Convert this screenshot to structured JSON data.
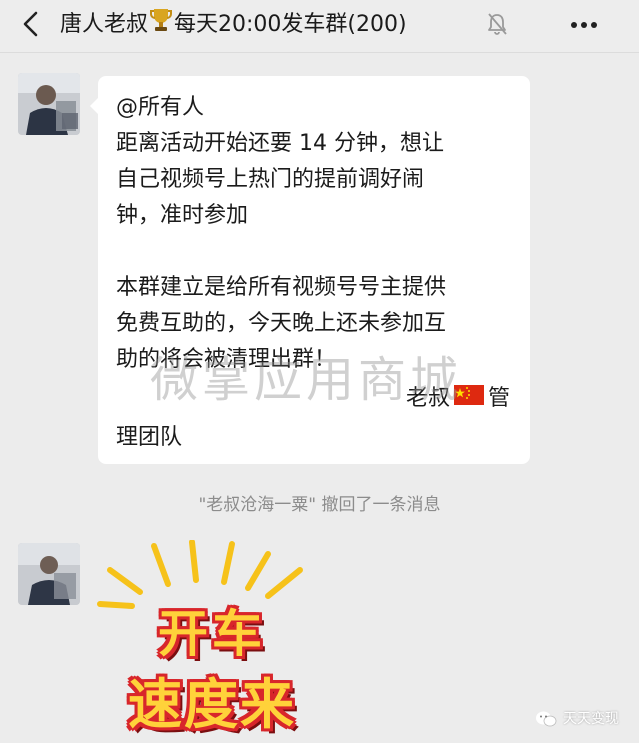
{
  "header": {
    "title_prefix": "唐人老叔",
    "title_suffix": "每天20:00发车群(200)",
    "icons": [
      "back-icon",
      "trophy-icon",
      "mute-bell-icon",
      "more-icon"
    ]
  },
  "message": {
    "lines_part1": [
      "@所有人",
      "距离活动开始还要 14 分钟，想让",
      "自己视频号上热门的提前调好闹",
      "钟，准时参加"
    ],
    "lines_part2": [
      "本群建立是给所有视频号号主提供",
      "免费互助的，今天晚上还未参加互",
      "助的将会被清理出群！"
    ],
    "signature_name": "老叔",
    "signature_role": "管",
    "signature_last": "理团队",
    "flag_icon": "china-flag-icon"
  },
  "watermark": "微掌应用商城",
  "recall_notice": "\"老叔沧海一粟\" 撤回了一条消息",
  "sticker": {
    "line1": "开车",
    "line2": "速度来"
  },
  "brand": {
    "name": "天天变现",
    "icon": "wechat-icon"
  },
  "colors": {
    "bubble": "#ffffff",
    "background": "#ececec",
    "sticker_fill": "#ffd23a",
    "sticker_outline": "#d8262b"
  }
}
